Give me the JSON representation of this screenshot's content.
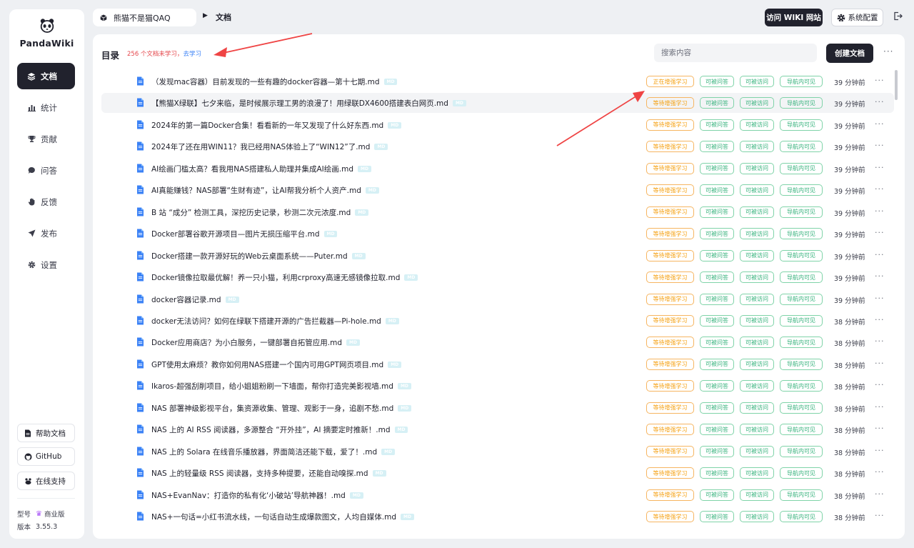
{
  "app": {
    "name": "PandaWiki"
  },
  "sidebar": {
    "items": [
      {
        "label": "文档",
        "icon": "layers-icon",
        "active": true
      },
      {
        "label": "统计",
        "icon": "bar-chart-icon"
      },
      {
        "label": "贡献",
        "icon": "trophy-icon"
      },
      {
        "label": "问答",
        "icon": "chat-bubble-icon"
      },
      {
        "label": "反馈",
        "icon": "hand-icon"
      },
      {
        "label": "发布",
        "icon": "send-icon"
      },
      {
        "label": "设置",
        "icon": "gear-icon"
      }
    ],
    "buttons": [
      {
        "label": "帮助文档",
        "icon": "document-icon"
      },
      {
        "label": "GitHub",
        "icon": "github-icon"
      },
      {
        "label": "在线支持",
        "icon": "support-icon"
      }
    ],
    "model_label": "型号",
    "model_value": "商业版",
    "version_label": "版本",
    "version_value": "3.55.3"
  },
  "topbar": {
    "workspace": "熊猫不是猫QAQ",
    "current": "文档",
    "visit_wiki": "访问 WIKI 网站",
    "system_config": "系统配置"
  },
  "panel": {
    "title": "目录",
    "unlearned_note": "256 个文档未学习，",
    "learn_link": "去学习",
    "search_placeholder": "搜索内容",
    "create_button": "创建文档",
    "more": "···"
  },
  "colors": {
    "accent_dark": "#21222d",
    "tag_learning": "#f59e0b",
    "tag_ok": "#34b27b",
    "annotation_arrow": "#ef4444"
  },
  "tags": {
    "qa": "可被问答",
    "visit": "可被访问",
    "nav": "导航内可见"
  },
  "documents": [
    {
      "title": "（发现mac容器）目前发现的一些有趣的docker容器—第十七期.md",
      "badge": "MD",
      "status": "正在增强学习",
      "time": "39 分钟前"
    },
    {
      "title": "【熊猫X绿联】七夕来临，是时候展示理工男的浪漫了！用绿联DX4600搭建表白网页.md",
      "badge": "MD",
      "status": "等待增强学习",
      "time": "39 分钟前"
    },
    {
      "title": "2024年的第一篇Docker合集！看看新的一年又发现了什么好东西.md",
      "badge": "MD",
      "status": "等待增强学习",
      "time": "39 分钟前"
    },
    {
      "title": "2024年了还在用WIN11？我已经用NAS体验上了“WIN12”了.md",
      "badge": "MD",
      "status": "等待增强学习",
      "time": "39 分钟前"
    },
    {
      "title": "AI绘画门槛太高？看我用NAS搭建私人助理并集成AI绘画.md",
      "badge": "MD",
      "status": "等待增强学习",
      "time": "39 分钟前"
    },
    {
      "title": "AI真能赚钱？NAS部署“生财有迹”，让AI帮我分析个人资产.md",
      "badge": "MD",
      "status": "等待增强学习",
      "time": "39 分钟前"
    },
    {
      "title": "B 站 “成分” 检测工具，深挖历史记录，秒测二次元浓度.md",
      "badge": "MD",
      "status": "等待增强学习",
      "time": "39 分钟前"
    },
    {
      "title": "Docker部署谷歌开源项目—图片无损压缩平台.md",
      "badge": "MD",
      "status": "等待增强学习",
      "time": "39 分钟前"
    },
    {
      "title": "Docker搭建一款开源好玩的Web云桌面系统——Puter.md",
      "badge": "MD",
      "status": "等待增强学习",
      "time": "39 分钟前"
    },
    {
      "title": "Docker镜像拉取最优解！养一只小猫，利用crproxy高速无感镜像拉取.md",
      "badge": "MD",
      "status": "等待增强学习",
      "time": "39 分钟前"
    },
    {
      "title": "docker容器记录.md",
      "badge": "MD",
      "status": "等待增强学习",
      "time": "39 分钟前"
    },
    {
      "title": "docker无法访问？如何在绿联下搭建开源的广告拦截器—Pi-hole.md",
      "badge": "MD",
      "status": "等待增强学习",
      "time": "38 分钟前"
    },
    {
      "title": "Docker应用商店？为小白服务，一键部署自拓管应用.md",
      "badge": "MD",
      "status": "等待增强学习",
      "time": "38 分钟前"
    },
    {
      "title": "GPT使用太麻烦？教你如何用NAS搭建一个国内可用GPT网页项目.md",
      "badge": "MD",
      "status": "等待增强学习",
      "time": "38 分钟前"
    },
    {
      "title": "Ikaros-超强刮削项目，给小姐姐粉刷一下墙面，帮你打造完美影视墙.md",
      "badge": "MD",
      "status": "等待增强学习",
      "time": "38 分钟前"
    },
    {
      "title": "NAS 部署神级影视平台，集资源收集、管理、观影于一身，追剧不愁.md",
      "badge": "MD",
      "status": "等待增强学习",
      "time": "38 分钟前"
    },
    {
      "title": "NAS 上的 AI RSS 阅读器，多源整合 “开外挂”，AI 摘要定时推新！.md",
      "badge": "MD",
      "status": "等待增强学习",
      "time": "38 分钟前"
    },
    {
      "title": "NAS 上的 Solara 在线音乐播放器，界面简洁还能下载，爱了！.md",
      "badge": "MD",
      "status": "等待增强学习",
      "time": "38 分钟前"
    },
    {
      "title": "NAS 上的轻量级 RSS 阅读器，支持多种提要，还能自动嗅探.md",
      "badge": "MD",
      "status": "等待增强学习",
      "time": "38 分钟前"
    },
    {
      "title": "NAS+EvanNav：打造你的私有化‘小破站’导航神器！.md",
      "badge": "MD",
      "status": "等待增强学习",
      "time": "38 分钟前"
    },
    {
      "title": "NAS+一句话=小红书流水线，一句话自动生成爆款图文，人均自媒体.md",
      "badge": "MD",
      "status": "等待增强学习",
      "time": "38 分钟前"
    }
  ]
}
